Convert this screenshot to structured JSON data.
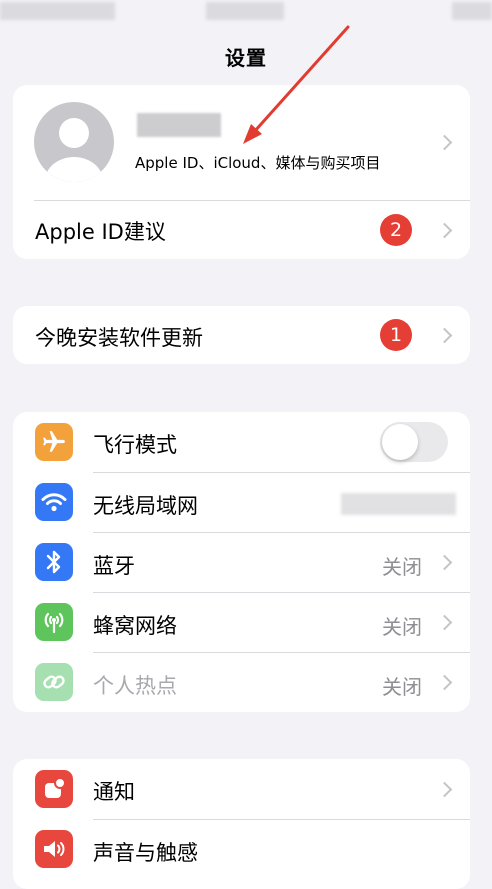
{
  "nav": {
    "title": "设置"
  },
  "profile": {
    "subtitle": "Apple ID、iCloud、媒体与购买项目",
    "suggestions_label": "Apple ID建议",
    "suggestions_badge": "2"
  },
  "update": {
    "label": "今晚安装软件更新",
    "badge": "1"
  },
  "connectivity": {
    "items": [
      {
        "label": "飞行模式",
        "icon": "airplane-icon",
        "icon_color": "#f3a23b",
        "toggle_on": false
      },
      {
        "label": "无线局域网",
        "icon": "wifi-icon",
        "icon_color": "#3478f6"
      },
      {
        "label": "蓝牙",
        "icon": "bluetooth-icon",
        "icon_color": "#3478f6",
        "value": "关闭"
      },
      {
        "label": "蜂窝网络",
        "icon": "cellular-icon",
        "icon_color": "#5ec45c",
        "value": "关闭"
      },
      {
        "label": "个人热点",
        "icon": "hotspot-icon",
        "icon_color": "#a6dfb0",
        "value": "关闭",
        "dimmed": true
      }
    ]
  },
  "system": {
    "items": [
      {
        "label": "通知",
        "icon": "notification-icon",
        "icon_color": "#e7473d"
      },
      {
        "label": "声音与触感",
        "icon": "sound-icon",
        "icon_color": "#e7473d"
      }
    ]
  },
  "colors": {
    "background": "#f2f2f7",
    "badge": "#e53e34",
    "annotation_arrow": "#e23b30"
  }
}
